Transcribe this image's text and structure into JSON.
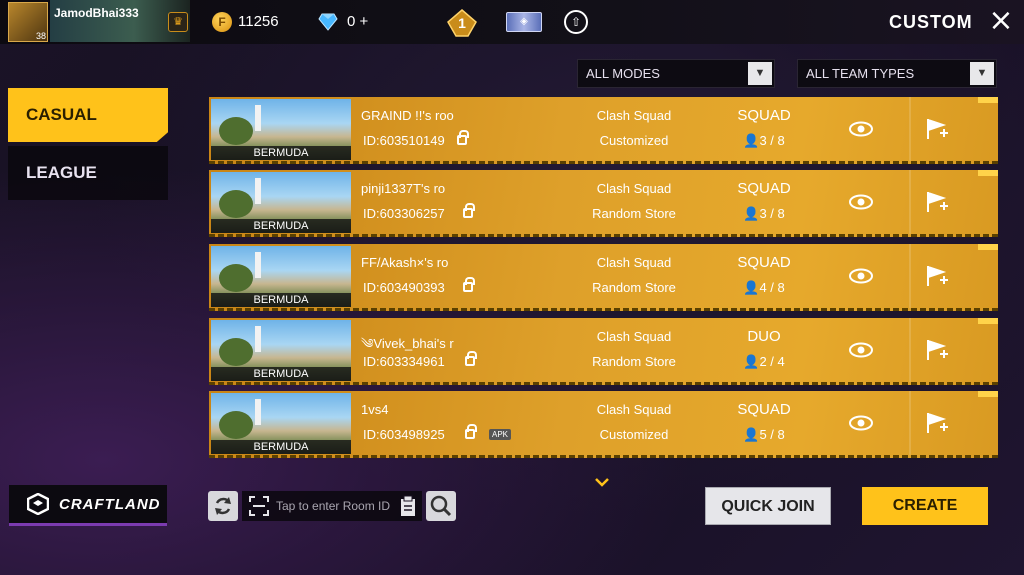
{
  "header": {
    "player_name": "JamodBhai333",
    "level": "38",
    "coins": "11256",
    "diamonds": "0 +",
    "rank_number": "1",
    "title": "CUSTOM"
  },
  "tabs": [
    {
      "label": "CASUAL",
      "active": true
    },
    {
      "label": "LEAGUE",
      "active": false
    }
  ],
  "filters": {
    "modes": "ALL MODES",
    "team_types": "ALL TEAM TYPES"
  },
  "rooms": [
    {
      "map": "BERMUDA",
      "name": "GRAIND  !!'s roo",
      "id": "ID:603510149",
      "mode": "Clash Squad",
      "sub": "Customized",
      "team": "SQUAD",
      "count": "3 / 8",
      "apk": ""
    },
    {
      "map": "BERMUDA",
      "name": "pinji1337T's ro",
      "id": "ID:603306257",
      "mode": "Clash Squad",
      "sub": "Random Store",
      "team": "SQUAD",
      "count": "3 / 8",
      "apk": ""
    },
    {
      "map": "BERMUDA",
      "name": "FF/Akash×'s ro",
      "id": "ID:603490393",
      "mode": "Clash Squad",
      "sub": "Random Store",
      "team": "SQUAD",
      "count": "4 / 8",
      "apk": ""
    },
    {
      "map": "BERMUDA",
      "name": "༄Vivek_bhai's r",
      "id": "ID:603334961",
      "mode": "Clash Squad",
      "sub": "Random Store",
      "team": "DUO",
      "count": "2 / 4",
      "apk": ""
    },
    {
      "map": "BERMUDA",
      "name": "1vs4",
      "id": "ID:603498925",
      "mode": "Clash Squad",
      "sub": "Customized",
      "team": "SQUAD",
      "count": "5 / 8",
      "apk": "APK"
    }
  ],
  "footer": {
    "craftland": "CRAFTLAND",
    "room_id_placeholder": "Tap to enter Room ID",
    "quick_join": "QUICK JOIN",
    "create": "CREATE"
  },
  "colors": {
    "accent": "#ffc21a",
    "row_bg": "#dea02a"
  }
}
